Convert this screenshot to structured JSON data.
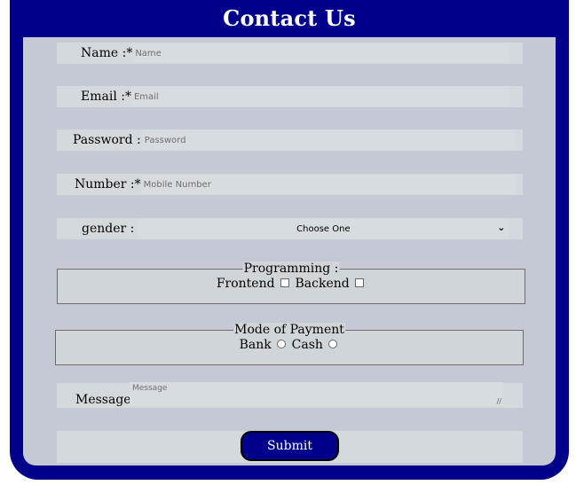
{
  "form": {
    "title": "Contact Us",
    "name": {
      "label": "Name :*",
      "placeholder": "Name"
    },
    "email": {
      "label": "Email :*",
      "placeholder": "Email"
    },
    "password": {
      "label": "Password :",
      "placeholder": "Password"
    },
    "number": {
      "label": "Number :*",
      "placeholder": "Mobile Number"
    },
    "gender": {
      "label": "gender :",
      "selected": "Choose One"
    },
    "programming": {
      "legend": "Programming :",
      "options": [
        "Frontend",
        "Backend"
      ]
    },
    "payment": {
      "legend": "Mode of Payment",
      "options": [
        "Bank",
        "Cash"
      ]
    },
    "message": {
      "label": "Message :",
      "placeholder": "Message"
    },
    "submit_label": "Submit"
  },
  "colors": {
    "header": "#00008b",
    "panel": "#c5c9d6",
    "field": "#d6dcdf"
  },
  "icons": {
    "select_arrow": "chevron-down-icon",
    "resize": "resize-grip-icon"
  }
}
